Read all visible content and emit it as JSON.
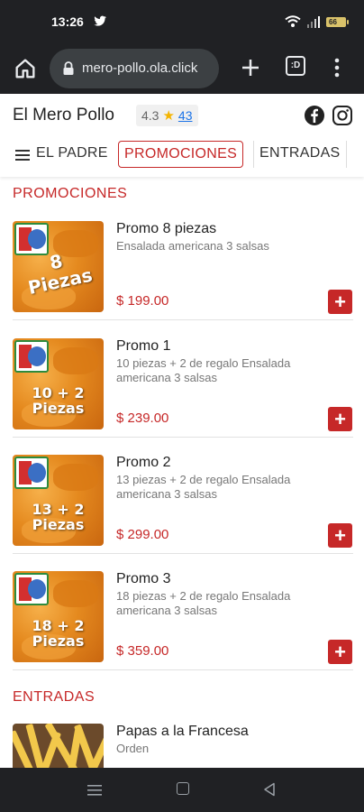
{
  "status_bar": {
    "time": "13:26"
  },
  "browser": {
    "url": "mero-pollo.ola.click",
    "tab_count": ":D"
  },
  "site": {
    "name": "El Mero Pollo",
    "rating": "4.3",
    "reviews": "43"
  },
  "nav": {
    "items": [
      "EL PADRE",
      "PROMOCIONES",
      "ENTRADAS"
    ],
    "active": "PROMOCIONES"
  },
  "sections": [
    {
      "title": "PROMOCIONES",
      "products": [
        {
          "name": "Promo 8 piezas",
          "description": "Ensalada americana 3 salsas",
          "price": "$ 199.00",
          "image_text": [
            "8",
            "Piezas"
          ]
        },
        {
          "name": "Promo 1",
          "description": "10 piezas + 2 de regalo Ensalada americana 3 salsas",
          "price": "$ 239.00",
          "image_text": [
            "10 + 2",
            "Piezas"
          ]
        },
        {
          "name": "Promo 2",
          "description": "13 piezas + 2 de regalo Ensalada americana 3 salsas",
          "price": "$ 299.00",
          "image_text": [
            "13 + 2",
            "Piezas"
          ]
        },
        {
          "name": "Promo 3",
          "description": "18 piezas + 2 de regalo Ensalada americana 3 salsas",
          "price": "$ 359.00",
          "image_text": [
            "18 + 2",
            "Piezas"
          ]
        }
      ]
    },
    {
      "title": "ENTRADAS",
      "products": [
        {
          "name": "Papas a la Francesa",
          "description": "Orden"
        }
      ]
    }
  ],
  "colors": {
    "accent": "#c62828",
    "chrome_dark": "#202124",
    "url_pill": "#3c4043",
    "star": "#f4b400",
    "link": "#1a73e8"
  },
  "icons": {
    "status": [
      "twitter-bird-icon",
      "wifi-icon",
      "signal-icon",
      "battery-icon"
    ],
    "browser": [
      "home-icon",
      "lock-icon",
      "new-tab-plus-icon",
      "tab-switcher-icon",
      "overflow-menu-icon"
    ],
    "site": [
      "star-icon",
      "facebook-icon",
      "instagram-icon",
      "hamburger-icon"
    ],
    "system_nav": [
      "recents-icon",
      "home-nav-icon",
      "back-icon"
    ]
  }
}
